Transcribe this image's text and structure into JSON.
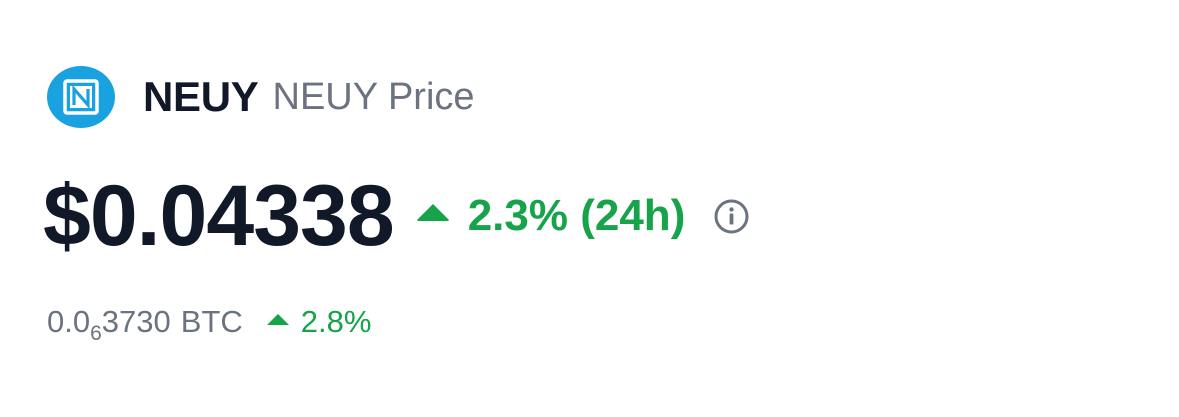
{
  "coin": {
    "symbol": "NEUY",
    "name": "NEUY Price",
    "logo_icon": "neuy-logo-icon",
    "logo_color": "#1aa2e0"
  },
  "price": {
    "usd": "$0.04338",
    "change_24h": "2.3% (24h)",
    "change_direction": "up",
    "change_color": "#16a34a",
    "info_icon": "info-icon"
  },
  "btc": {
    "prefix": "0.0",
    "zeros_subscript": "6",
    "digits": "3730",
    "unit": "BTC",
    "change": "2.8%",
    "change_direction": "up"
  }
}
